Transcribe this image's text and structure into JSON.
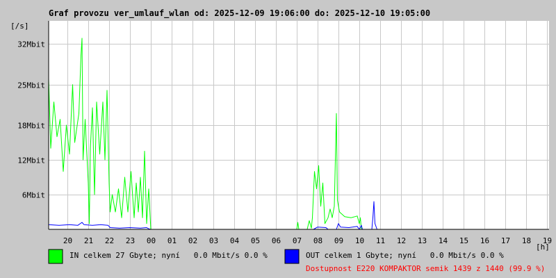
{
  "chart_data": {
    "type": "line",
    "title": "Graf provozu ver_umlauf_wlan od: 2025-12-09 19:06:00 do: 2025-12-10 19:05:00",
    "ylabel": "[/s]",
    "xlabel": "[h]",
    "y_tick_values": [
      6,
      12,
      18,
      25,
      32
    ],
    "y_tick_labels": [
      "6Mbit",
      "12Mbit",
      "18Mbit",
      "25Mbit",
      "32Mbit"
    ],
    "ylim": [
      0,
      36
    ],
    "y_unit": "Mbit/s",
    "x_tick_values": [
      20,
      21,
      22,
      23,
      24,
      25,
      26,
      27,
      28,
      29,
      30,
      31,
      32,
      33,
      34,
      35,
      36,
      37,
      38,
      39,
      40,
      41,
      42,
      43
    ],
    "x_tick_labels": [
      "20",
      "21",
      "22",
      "23",
      "00",
      "01",
      "02",
      "03",
      "04",
      "05",
      "06",
      "07",
      "08",
      "09",
      "10",
      "11",
      "12",
      "13",
      "14",
      "15",
      "16",
      "17",
      "18",
      "19"
    ],
    "xlim": [
      19.1,
      43.1
    ],
    "x_unit": "hours since 2025-12-09 00:00",
    "grid": true,
    "series": [
      {
        "name": "IN",
        "color": "#00ff00",
        "points": [
          [
            19.1,
            26
          ],
          [
            19.2,
            14
          ],
          [
            19.35,
            22
          ],
          [
            19.5,
            16
          ],
          [
            19.65,
            19
          ],
          [
            19.8,
            10
          ],
          [
            19.95,
            18
          ],
          [
            20.1,
            13
          ],
          [
            20.25,
            25
          ],
          [
            20.35,
            15
          ],
          [
            20.55,
            20
          ],
          [
            20.65,
            30
          ],
          [
            20.7,
            33
          ],
          [
            20.75,
            12
          ],
          [
            20.85,
            19
          ],
          [
            21.0,
            8
          ],
          [
            21.05,
            1
          ],
          [
            21.1,
            14
          ],
          [
            21.2,
            21
          ],
          [
            21.3,
            6
          ],
          [
            21.4,
            22
          ],
          [
            21.55,
            13
          ],
          [
            21.7,
            22
          ],
          [
            21.8,
            12
          ],
          [
            21.9,
            24
          ],
          [
            22.0,
            8
          ],
          [
            22.05,
            3
          ],
          [
            22.15,
            6
          ],
          [
            22.3,
            3
          ],
          [
            22.45,
            7
          ],
          [
            22.6,
            2
          ],
          [
            22.75,
            9
          ],
          [
            22.9,
            3
          ],
          [
            23.05,
            10
          ],
          [
            23.2,
            2
          ],
          [
            23.3,
            8
          ],
          [
            23.4,
            3
          ],
          [
            23.5,
            9
          ],
          [
            23.6,
            2
          ],
          [
            23.7,
            13.5
          ],
          [
            23.8,
            1
          ],
          [
            23.9,
            7
          ],
          [
            24.0,
            0
          ],
          [
            26.0,
            0
          ],
          [
            28.0,
            0
          ],
          [
            30.0,
            0
          ],
          [
            31.0,
            0
          ],
          [
            31.05,
            1.2
          ],
          [
            31.1,
            0
          ],
          [
            31.5,
            0
          ],
          [
            31.6,
            1.5
          ],
          [
            31.7,
            0.2
          ],
          [
            31.75,
            2
          ],
          [
            31.85,
            10
          ],
          [
            31.95,
            7
          ],
          [
            32.05,
            11
          ],
          [
            32.15,
            4
          ],
          [
            32.25,
            8
          ],
          [
            32.35,
            1
          ],
          [
            32.5,
            2
          ],
          [
            32.6,
            3.5
          ],
          [
            32.7,
            2
          ],
          [
            32.8,
            4
          ],
          [
            32.9,
            20
          ],
          [
            32.95,
            5
          ],
          [
            33.05,
            3
          ],
          [
            33.3,
            2.2
          ],
          [
            33.6,
            2
          ],
          [
            33.9,
            2.3
          ],
          [
            34.0,
            1
          ],
          [
            34.05,
            2
          ],
          [
            34.1,
            0
          ],
          [
            36.0,
            0
          ],
          [
            38.0,
            0
          ],
          [
            40.0,
            0
          ],
          [
            43.1,
            0
          ]
        ]
      },
      {
        "name": "OUT",
        "color": "#0000ff",
        "points": [
          [
            19.1,
            0.8
          ],
          [
            19.6,
            0.7
          ],
          [
            20.1,
            0.8
          ],
          [
            20.5,
            0.7
          ],
          [
            20.7,
            1.2
          ],
          [
            20.8,
            0.8
          ],
          [
            21.2,
            0.7
          ],
          [
            21.6,
            0.8
          ],
          [
            21.95,
            0.7
          ],
          [
            22.05,
            0.3
          ],
          [
            22.5,
            0.2
          ],
          [
            23.0,
            0.3
          ],
          [
            23.5,
            0.2
          ],
          [
            23.8,
            0.3
          ],
          [
            23.9,
            0.1
          ],
          [
            24.0,
            0
          ],
          [
            31.0,
            0
          ],
          [
            31.8,
            0
          ],
          [
            32.0,
            0.4
          ],
          [
            32.4,
            0.3
          ],
          [
            32.5,
            0
          ],
          [
            32.9,
            0
          ],
          [
            33.0,
            1
          ],
          [
            33.1,
            0.4
          ],
          [
            33.5,
            0.3
          ],
          [
            33.9,
            0.5
          ],
          [
            34.0,
            0
          ],
          [
            34.1,
            0.7
          ],
          [
            34.15,
            0
          ],
          [
            34.6,
            0
          ],
          [
            34.65,
            2
          ],
          [
            34.7,
            4.8
          ],
          [
            34.75,
            1
          ],
          [
            34.85,
            0
          ],
          [
            36.0,
            0
          ],
          [
            40.0,
            0
          ],
          [
            43.1,
            0
          ]
        ]
      }
    ],
    "legend": [
      {
        "name": "IN",
        "color": "#00ff00",
        "text": "IN celkem 27 Gbyte; nyní   0.0 Mbit/s 0.0 %"
      },
      {
        "name": "OUT",
        "color": "#0000ff",
        "text": "OUT celkem 1 Gbyte; nyní   0.0 Mbit/s 0.0 %"
      }
    ],
    "availability": {
      "text": "Dostupnost E220 KOMPAKTOR semik 1439 z 1440 (99.9 %)",
      "color": "#ff0000"
    }
  }
}
